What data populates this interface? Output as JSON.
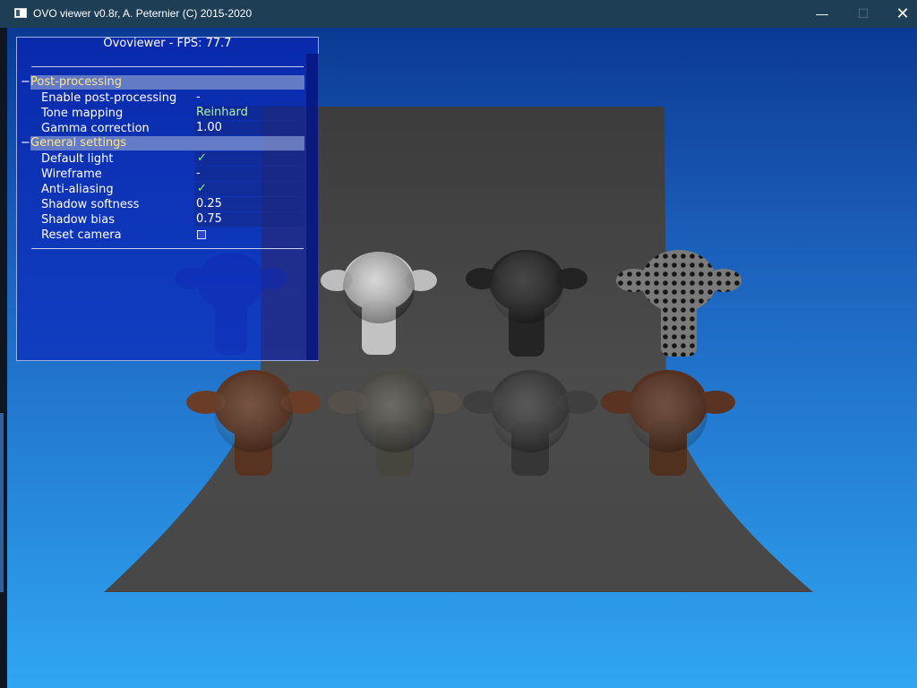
{
  "window": {
    "title": "OVO viewer v0.8r, A. Peternier (C) 2015-2020",
    "controls": {
      "minimize": "—",
      "maximize": "☐",
      "close": "✕"
    }
  },
  "panel": {
    "title": "Ovoviewer - FPS: 77.7",
    "sections": [
      {
        "toggle": "−",
        "label": "Post-processing",
        "rows": [
          {
            "label": "Enable post-processing",
            "value": "-"
          },
          {
            "label": "Tone mapping",
            "value": "Reinhard"
          },
          {
            "label": "Gamma correction",
            "value": "1.00"
          }
        ]
      },
      {
        "toggle": "−",
        "label": "General settings",
        "rows": [
          {
            "label": "Default light",
            "value": "✓"
          },
          {
            "label": "Wireframe",
            "value": "-"
          },
          {
            "label": "Anti-aliasing",
            "value": "✓"
          },
          {
            "label": "Shadow softness",
            "value": "0.25"
          },
          {
            "label": "Shadow bias",
            "value": "0.75"
          },
          {
            "label": "Reset camera",
            "value": ""
          }
        ]
      }
    ]
  },
  "colors": {
    "section_header_text": "#ffe68a",
    "accent_value": "#aaf3a0",
    "check": "#8ef08a",
    "panel_bg": "#0a1eb9",
    "sky_top": "#0b3a93",
    "sky_bottom": "#30a6f2",
    "floor": "#4a4a4a"
  },
  "scene": {
    "monkeys": [
      {
        "name": "monkey-blue-translucent",
        "color": "#1a3db0"
      },
      {
        "name": "monkey-white",
        "color": "#d8d8d8"
      },
      {
        "name": "monkey-black",
        "color": "#2a2a2a"
      },
      {
        "name": "monkey-spotted",
        "color": "#6a6a6a"
      },
      {
        "name": "monkey-rusty-1",
        "color": "#6b3d26"
      },
      {
        "name": "monkey-stone",
        "color": "#4d4a44"
      },
      {
        "name": "monkey-dark-grey",
        "color": "#3c3c3c"
      },
      {
        "name": "monkey-rusty-2",
        "color": "#5a3322"
      }
    ]
  }
}
